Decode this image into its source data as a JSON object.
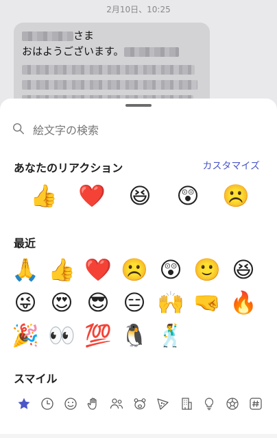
{
  "chat": {
    "timestamp": "2月10日、10:25",
    "greeting_suffix": "さま",
    "message_line": "おはようございます。"
  },
  "sheet": {
    "search_placeholder": "絵文字の検索",
    "reactions_title": "あなたのリアクション",
    "customize_label": "カスタマイズ",
    "recent_title": "最近",
    "smile_title": "スマイル",
    "reactions": [
      {
        "name": "thumbs-up",
        "glyph": "👍"
      },
      {
        "name": "red-heart",
        "glyph": "❤️"
      },
      {
        "name": "laughing",
        "glyph": "😆"
      },
      {
        "name": "surprised",
        "glyph": "😲"
      },
      {
        "name": "frowning",
        "glyph": "☹️"
      }
    ],
    "recent": [
      {
        "name": "folded-hands",
        "glyph": "🙏"
      },
      {
        "name": "thumbs-up",
        "glyph": "👍"
      },
      {
        "name": "red-heart",
        "glyph": "❤️"
      },
      {
        "name": "frowning",
        "glyph": "☹️"
      },
      {
        "name": "surprised",
        "glyph": "😲"
      },
      {
        "name": "smiling",
        "glyph": "🙂"
      },
      {
        "name": "laughing",
        "glyph": "😆"
      },
      {
        "name": "winking-tongue",
        "glyph": "😜"
      },
      {
        "name": "heart-eyes",
        "glyph": "😍"
      },
      {
        "name": "sunglasses",
        "glyph": "😎"
      },
      {
        "name": "expressionless",
        "glyph": "😑"
      },
      {
        "name": "raising-hands",
        "glyph": "🙌"
      },
      {
        "name": "fist-bump",
        "glyph": "🤜"
      },
      {
        "name": "fire",
        "glyph": "🔥"
      },
      {
        "name": "party-popper",
        "glyph": "🎉"
      },
      {
        "name": "eyes",
        "glyph": "👀"
      },
      {
        "name": "hundred-points",
        "glyph": "💯"
      },
      {
        "name": "penguin",
        "glyph": "🐧"
      },
      {
        "name": "dancer",
        "glyph": "🕺"
      }
    ],
    "categories": [
      "star",
      "clock",
      "smiley",
      "hand",
      "people",
      "animal",
      "food",
      "building",
      "lightbulb",
      "ball",
      "hash"
    ],
    "accent": "#4a55c8"
  }
}
